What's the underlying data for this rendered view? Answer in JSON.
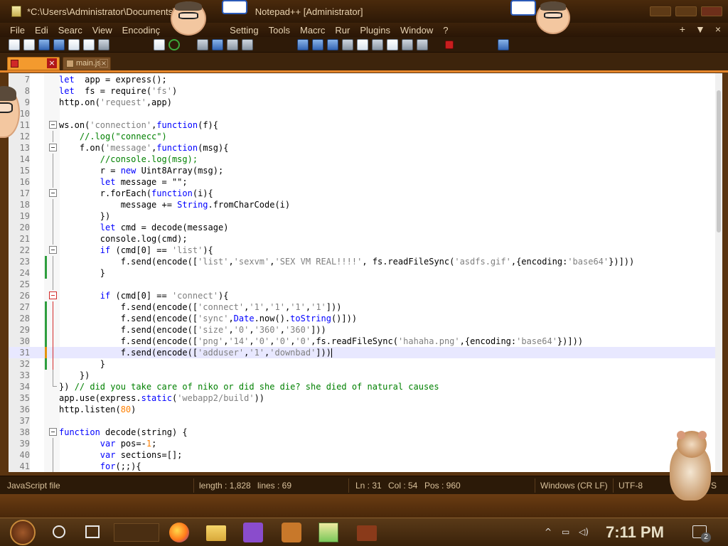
{
  "window": {
    "title": "*C:\\Users\\Administrator\\Documents\\",
    "title_suffix": "Notepad++ [Administrator]"
  },
  "menu": {
    "items": [
      "File",
      "Edi",
      "Searc",
      "View",
      "Encodinç",
      "Setting",
      "Tools",
      "Macrc",
      "Rur",
      "Plugins",
      "Window",
      "?"
    ],
    "right": [
      "+",
      "▼",
      "×"
    ]
  },
  "tabs": [
    {
      "label": "",
      "active": true
    },
    {
      "label": "main.js",
      "active": false
    }
  ],
  "editor": {
    "language": "JavaScript",
    "current_line": 31,
    "lines": [
      {
        "n": "7",
        "parts": [
          [
            "kw",
            "let"
          ],
          [
            "",
            "  app = express();"
          ]
        ]
      },
      {
        "n": "8",
        "parts": [
          [
            "kw",
            "let"
          ],
          [
            "",
            "  fs = require("
          ],
          [
            "str",
            "'fs'"
          ],
          [
            "",
            ")"
          ]
        ]
      },
      {
        "n": "9",
        "parts": [
          [
            "",
            "http.on("
          ],
          [
            "str",
            "'request'"
          ],
          [
            "",
            ",app)"
          ]
        ]
      },
      {
        "n": "10",
        "parts": []
      },
      {
        "n": "11",
        "parts": [
          [
            "",
            "ws.on("
          ],
          [
            "str",
            "'connection'"
          ],
          [
            "",
            ","
          ],
          [
            "kw",
            "function"
          ],
          [
            "",
            "(f){"
          ]
        ]
      },
      {
        "n": "12",
        "parts": [
          [
            "",
            "    "
          ],
          [
            "cmt",
            "//.log(\"connecc\")"
          ]
        ]
      },
      {
        "n": "13",
        "parts": [
          [
            "",
            "    f.on("
          ],
          [
            "str",
            "'message'"
          ],
          [
            "",
            ","
          ],
          [
            "kw",
            "function"
          ],
          [
            "",
            "(msg){"
          ]
        ]
      },
      {
        "n": "14",
        "parts": [
          [
            "",
            "        "
          ],
          [
            "cmt",
            "//console.log(msg);"
          ]
        ]
      },
      {
        "n": "15",
        "parts": [
          [
            "",
            "        r = "
          ],
          [
            "kw",
            "new"
          ],
          [
            "",
            " Uint8Array(msg);"
          ]
        ]
      },
      {
        "n": "16",
        "parts": [
          [
            "",
            "        "
          ],
          [
            "kw",
            "let"
          ],
          [
            "",
            " message = \"\";"
          ]
        ]
      },
      {
        "n": "17",
        "parts": [
          [
            "",
            "        r.forEach("
          ],
          [
            "kw",
            "function"
          ],
          [
            "",
            "(i){"
          ]
        ]
      },
      {
        "n": "18",
        "parts": [
          [
            "",
            "            message += "
          ],
          [
            "kw",
            "String"
          ],
          [
            "",
            ".fromCharCode(i)"
          ]
        ]
      },
      {
        "n": "19",
        "parts": [
          [
            "",
            "        })"
          ]
        ]
      },
      {
        "n": "20",
        "parts": [
          [
            "",
            "        "
          ],
          [
            "kw",
            "let"
          ],
          [
            "",
            " cmd = decode(message)"
          ]
        ]
      },
      {
        "n": "21",
        "parts": [
          [
            "",
            "        console.log(cmd);"
          ]
        ]
      },
      {
        "n": "22",
        "parts": [
          [
            "",
            "        "
          ],
          [
            "kw",
            "if"
          ],
          [
            "",
            " (cmd[0] == "
          ],
          [
            "str",
            "'list'"
          ],
          [
            "",
            "){"
          ]
        ]
      },
      {
        "n": "23",
        "parts": [
          [
            "",
            "            f.send(encode(["
          ],
          [
            "str",
            "'list'"
          ],
          [
            "",
            ","
          ],
          [
            "str",
            "'sexvm'"
          ],
          [
            "",
            ","
          ],
          [
            "str",
            "'SEX VM REAL!!!!'"
          ],
          [
            "",
            ", fs.readFileSync("
          ],
          [
            "str",
            "'asdfs.gif'"
          ],
          [
            "",
            ",{encoding:"
          ],
          [
            "str",
            "'base64'"
          ],
          [
            "",
            "})]))"
          ]
        ]
      },
      {
        "n": "24",
        "parts": [
          [
            "",
            "        }"
          ]
        ]
      },
      {
        "n": "25",
        "parts": []
      },
      {
        "n": "26",
        "parts": [
          [
            "",
            "        "
          ],
          [
            "kw",
            "if"
          ],
          [
            "",
            " (cmd[0] == "
          ],
          [
            "str",
            "'connect'"
          ],
          [
            "",
            "){"
          ]
        ]
      },
      {
        "n": "27",
        "parts": [
          [
            "",
            "            f.send(encode(["
          ],
          [
            "str",
            "'connect'"
          ],
          [
            "",
            ","
          ],
          [
            "str",
            "'1'"
          ],
          [
            "",
            ","
          ],
          [
            "str",
            "'1'"
          ],
          [
            "",
            ","
          ],
          [
            "str",
            "'1'"
          ],
          [
            "",
            ","
          ],
          [
            "str",
            "'1'"
          ],
          [
            "",
            "]))"
          ]
        ]
      },
      {
        "n": "28",
        "parts": [
          [
            "",
            "            f.send(encode(["
          ],
          [
            "str",
            "'sync'"
          ],
          [
            "",
            ","
          ],
          [
            "kw",
            "Date"
          ],
          [
            "",
            ".now()."
          ],
          [
            "kw",
            "toString"
          ],
          [
            "",
            "()]))"
          ]
        ]
      },
      {
        "n": "29",
        "parts": [
          [
            "",
            "            f.send(encode(["
          ],
          [
            "str",
            "'size'"
          ],
          [
            "",
            ","
          ],
          [
            "str",
            "'0'"
          ],
          [
            "",
            ","
          ],
          [
            "str",
            "'360'"
          ],
          [
            "",
            ","
          ],
          [
            "str",
            "'360'"
          ],
          [
            "",
            "]))"
          ]
        ]
      },
      {
        "n": "30",
        "parts": [
          [
            "",
            "            f.send(encode(["
          ],
          [
            "str",
            "'png'"
          ],
          [
            "",
            ","
          ],
          [
            "str",
            "'14'"
          ],
          [
            "",
            ","
          ],
          [
            "str",
            "'0'"
          ],
          [
            "",
            ","
          ],
          [
            "str",
            "'0'"
          ],
          [
            "",
            ","
          ],
          [
            "str",
            "'0'"
          ],
          [
            "",
            ",fs.readFileSync("
          ],
          [
            "str",
            "'hahaha.png'"
          ],
          [
            "",
            ",{encoding:"
          ],
          [
            "str",
            "'base64'"
          ],
          [
            "",
            "})]))"
          ]
        ]
      },
      {
        "n": "31",
        "parts": [
          [
            "",
            "            f.send(encode(["
          ],
          [
            "str",
            "'adduser'"
          ],
          [
            "",
            ","
          ],
          [
            "str",
            "'1'"
          ],
          [
            "",
            ","
          ],
          [
            "str",
            "'downbad'"
          ],
          [
            "",
            "]))"
          ]
        ]
      },
      {
        "n": "32",
        "parts": [
          [
            "",
            "        }"
          ]
        ]
      },
      {
        "n": "33",
        "parts": [
          [
            "",
            "    })"
          ]
        ]
      },
      {
        "n": "34",
        "parts": [
          [
            "",
            "}) "
          ],
          [
            "cmt",
            "// did you take care of niko or did she die? she died of natural causes"
          ]
        ]
      },
      {
        "n": "35",
        "parts": [
          [
            "",
            "app.use(express."
          ],
          [
            "kw",
            "static"
          ],
          [
            "",
            "("
          ],
          [
            "str",
            "'webapp2/build'"
          ],
          [
            "",
            "))"
          ]
        ]
      },
      {
        "n": "36",
        "parts": [
          [
            "",
            "http.listen("
          ],
          [
            "num",
            "80"
          ],
          [
            "",
            ")"
          ]
        ]
      },
      {
        "n": "37",
        "parts": []
      },
      {
        "n": "38",
        "parts": [
          [
            "kw",
            "function"
          ],
          [
            "",
            " decode(string) {"
          ]
        ]
      },
      {
        "n": "39",
        "parts": [
          [
            "",
            "        "
          ],
          [
            "kw",
            "var"
          ],
          [
            "",
            " pos=-"
          ],
          [
            "num",
            "1"
          ],
          [
            "",
            ";"
          ]
        ]
      },
      {
        "n": "40",
        "parts": [
          [
            "",
            "        "
          ],
          [
            "kw",
            "var"
          ],
          [
            "",
            " sections=[];"
          ]
        ]
      },
      {
        "n": "41",
        "parts": [
          [
            "",
            "        "
          ],
          [
            "kw",
            "for"
          ],
          [
            "",
            "(;;){"
          ]
        ]
      }
    ]
  },
  "statusbar": {
    "file_type": "JavaScript file",
    "length": "length : 1,828",
    "lines": "lines : 69",
    "ln": "Ln : 31",
    "col": "Col : 54",
    "pos": "Pos : 960",
    "eol": "Windows (CR LF)",
    "encoding": "UTF-8",
    "mode": "S"
  },
  "taskbar": {
    "clock": "7:11 PM",
    "notification_count": "2"
  }
}
